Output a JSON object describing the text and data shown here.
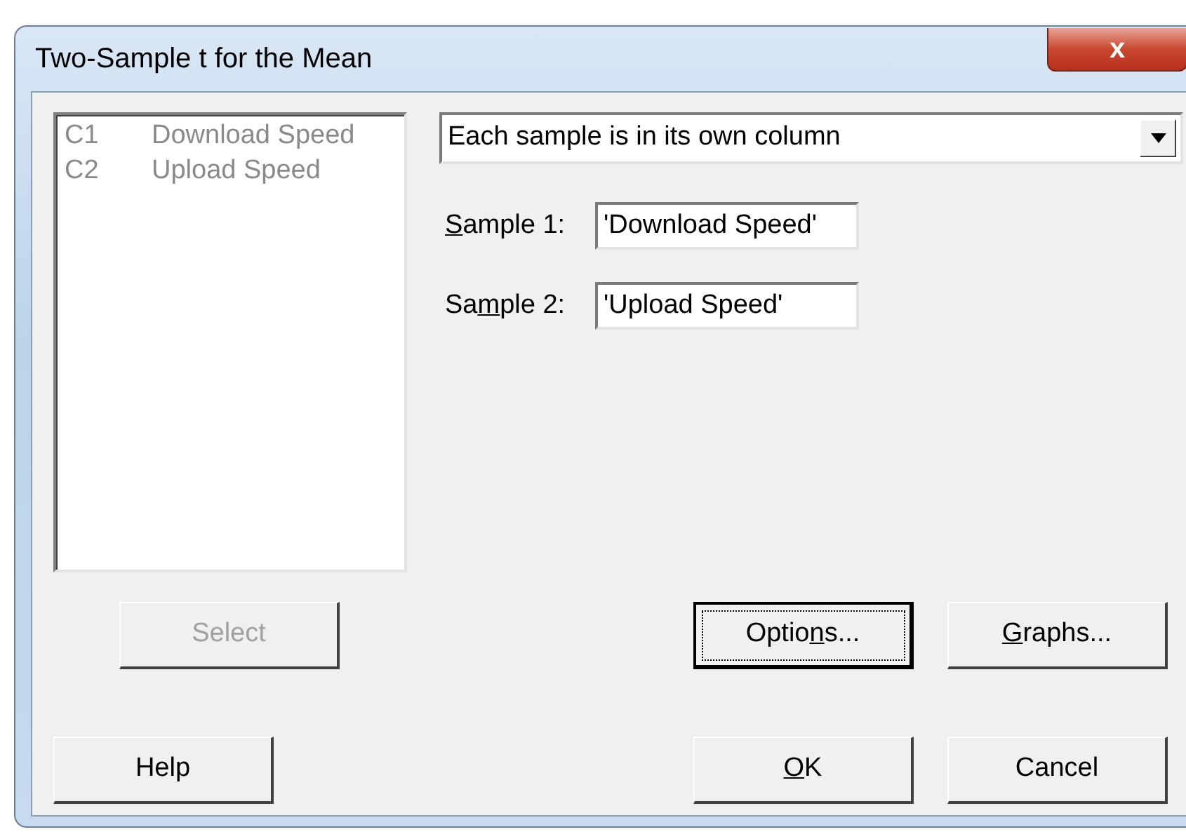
{
  "window": {
    "title": "Two-Sample t for the Mean",
    "close_glyph": "x"
  },
  "variables_list": {
    "disabled": true,
    "items": [
      {
        "column": "C1",
        "name": "Download Speed"
      },
      {
        "column": "C2",
        "name": "Upload Speed"
      }
    ]
  },
  "data_arrangement": {
    "value": "Each sample is in its own column"
  },
  "fields": [
    {
      "access_key": "S",
      "label_after": "ample 1:",
      "value": "'Download Speed'"
    },
    {
      "label_before": "Sa",
      "access_key": "m",
      "label_after": "ple 2:",
      "value": "'Upload Speed'"
    }
  ],
  "buttons": [
    {
      "kind": "select",
      "label_before": "Select",
      "disabled": true,
      "focused": false
    },
    {
      "kind": "options",
      "label_before": "Optio",
      "access_key": "n",
      "label_after": "s...",
      "disabled": false,
      "focused": true
    },
    {
      "kind": "graphs",
      "access_key": "G",
      "label_after": "raphs...",
      "disabled": false,
      "focused": false
    },
    {
      "kind": "help",
      "label_before": "Help",
      "disabled": false,
      "focused": false
    },
    {
      "kind": "ok",
      "access_key": "O",
      "label_after": "K",
      "disabled": false,
      "focused": false
    },
    {
      "kind": "cancel",
      "label_before": "Cancel",
      "disabled": false,
      "focused": false
    }
  ]
}
